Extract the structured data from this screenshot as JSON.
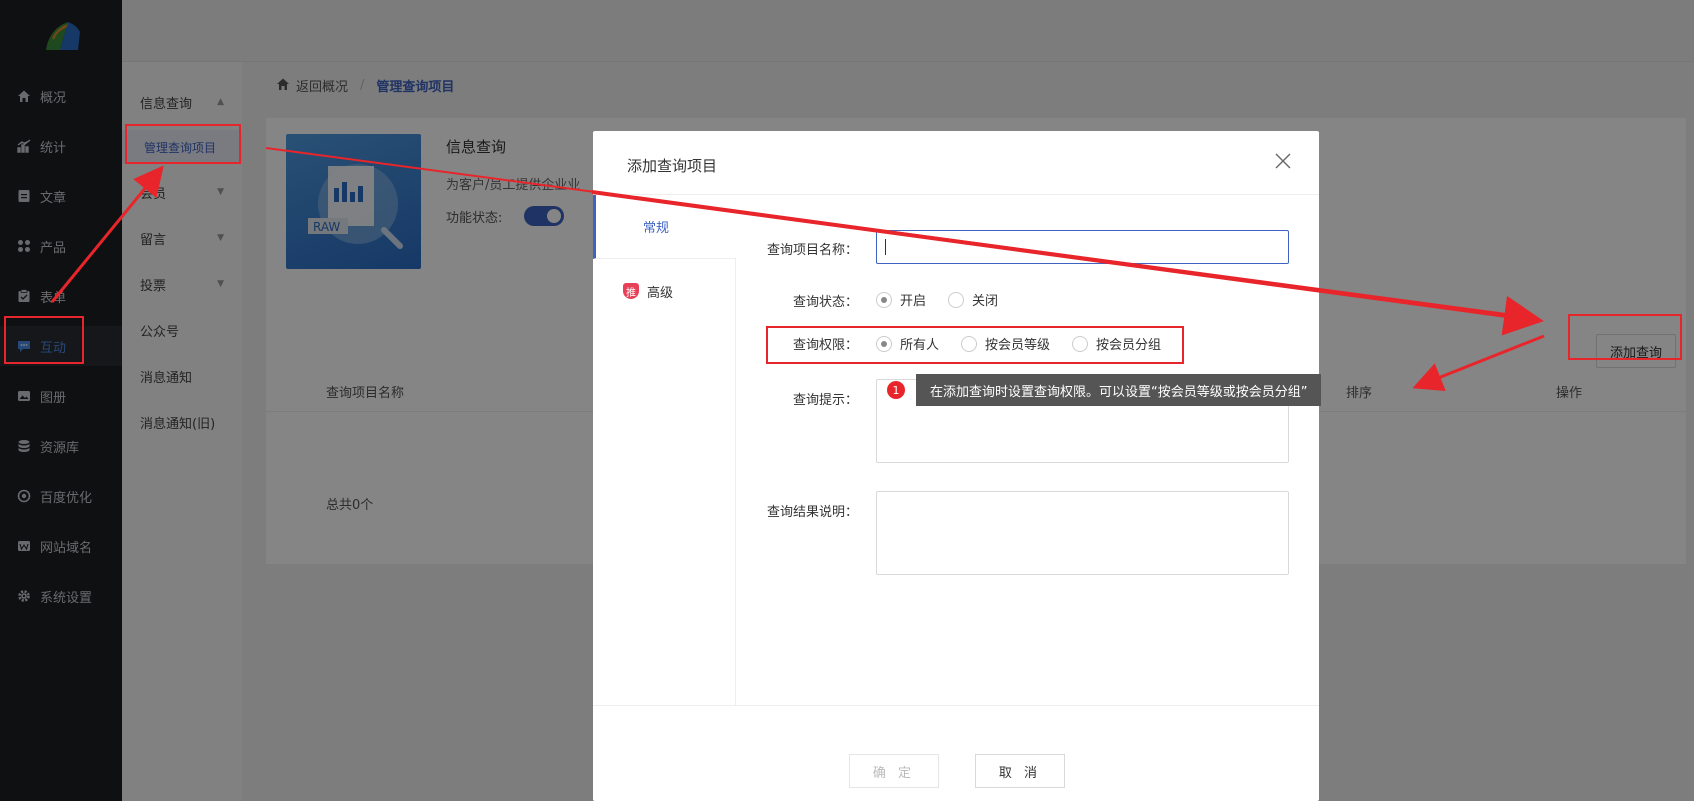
{
  "nav": {
    "items": [
      {
        "label": "概况",
        "icon": "home-icon"
      },
      {
        "label": "统计",
        "icon": "chart-icon"
      },
      {
        "label": "文章",
        "icon": "article-icon"
      },
      {
        "label": "产品",
        "icon": "grid-icon"
      },
      {
        "label": "表单",
        "icon": "form-icon"
      },
      {
        "label": "互动",
        "icon": "chat-icon"
      },
      {
        "label": "图册",
        "icon": "image-icon"
      },
      {
        "label": "资源库",
        "icon": "database-icon"
      },
      {
        "label": "百度优化",
        "icon": "seo-icon"
      },
      {
        "label": "网站域名",
        "icon": "domain-icon"
      },
      {
        "label": "系统设置",
        "icon": "gear-icon"
      }
    ]
  },
  "subnav": {
    "items": [
      "信息查询",
      "管理查询项目",
      "会员",
      "留言",
      "投票",
      "公众号",
      "消息通知",
      "消息通知(旧)"
    ]
  },
  "breadcrumb": {
    "back": "返回概况",
    "current": "管理查询项目"
  },
  "feature": {
    "title": "信息查询",
    "desc": "为客户/员工提供企业业",
    "state_label": "功能状态:",
    "thumb_text": "RAW"
  },
  "table": {
    "columns": [
      "查询项目名称",
      "排序",
      "操作"
    ],
    "total": "总共0个",
    "add_button": "添加查询"
  },
  "modal": {
    "title": "添加查询项目",
    "tabs": {
      "general": "常规",
      "advanced": "高级",
      "advanced_badge": "推"
    },
    "fields": {
      "name_label": "查询项目名称：",
      "name_value": "",
      "status_label": "查询状态：",
      "status_options": [
        "开启",
        "关闭"
      ],
      "permission_label": "查询权限：",
      "permission_options": [
        "所有人",
        "按会员等级",
        "按会员分组"
      ],
      "hint_label": "查询提示：",
      "result_label": "查询结果说明："
    },
    "ok": "确 定",
    "cancel": "取 消"
  },
  "annotation": {
    "number": "1",
    "text": "在添加查询时设置查询权限。可以设置“按会员等级或按会员分组”",
    "color": "#e8252a"
  }
}
